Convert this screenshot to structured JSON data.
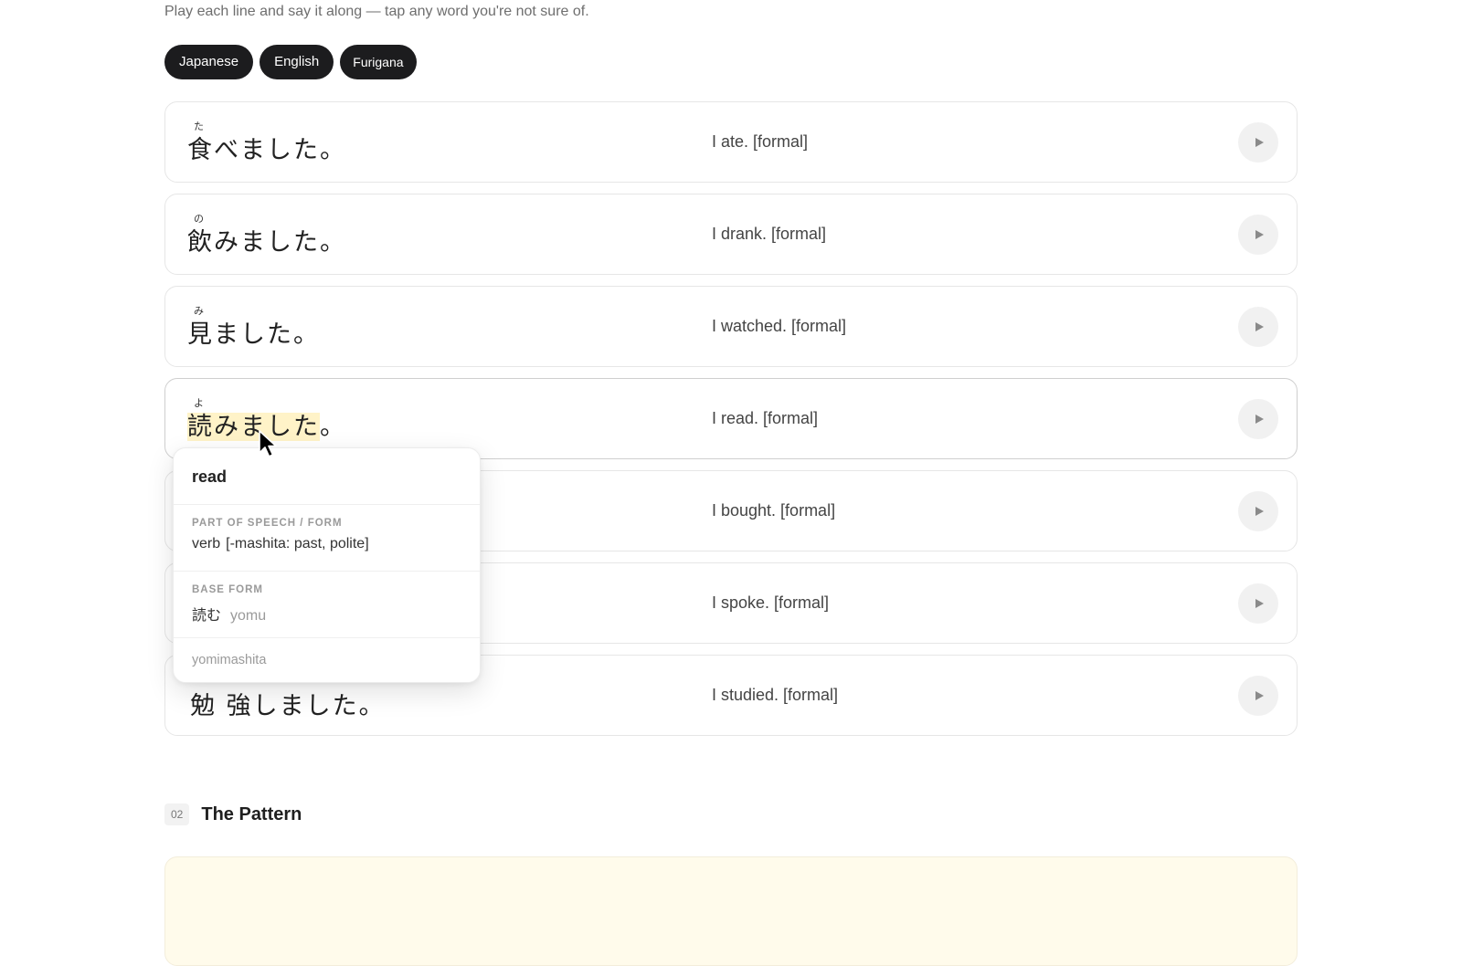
{
  "subtitle": "Play each line and say it along — tap any word you're not sure of.",
  "toggles": [
    {
      "label": "Japanese"
    },
    {
      "label": "English"
    },
    {
      "label": "Furigana"
    }
  ],
  "rows": [
    {
      "reading": "た",
      "kanji": "食",
      "rest": "べました。",
      "translation": "I ate. [formal]"
    },
    {
      "reading": "の",
      "kanji": "飲",
      "rest": "みました。",
      "translation": "I drank. [formal]"
    },
    {
      "reading": "み",
      "kanji": "見",
      "rest": "ました。",
      "translation": "I watched. [formal]"
    },
    {
      "reading": "よ",
      "kanji": "読みました",
      "rest": "。",
      "translation": "I read. [formal]"
    },
    {
      "reading": "",
      "kanji": "",
      "rest": "",
      "translation": "I bought. [formal]"
    },
    {
      "reading": "",
      "kanji": "",
      "rest": "",
      "translation": "I spoke. [formal]"
    },
    {
      "reading": "",
      "kanji": "",
      "rest": "勉 強しました。",
      "translation": "I studied. [formal]"
    }
  ],
  "popover": {
    "word": "read",
    "pos_label": "PART OF SPEECH / FORM",
    "pos": "verb",
    "form": "[-mashita: past, polite]",
    "base_label": "BASE FORM",
    "base": "読む",
    "base_romaji": "yomu",
    "romaji": "yomimashita"
  },
  "section": {
    "number": "02",
    "title": "The Pattern"
  },
  "colors": {
    "highlight": "#fff3c8",
    "pill_bg": "#1c1c1e",
    "pattern_bg": "#fffbeb"
  },
  "icons": {
    "play": "play-icon",
    "cursor": "mouse-pointer-icon"
  }
}
